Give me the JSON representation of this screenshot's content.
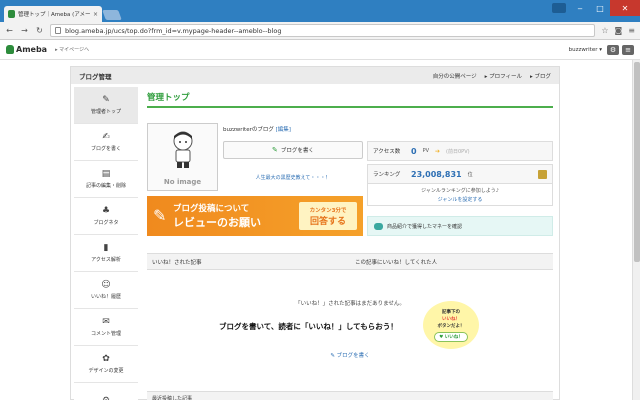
{
  "browser": {
    "tab_title": "管理トップ｜Ameba (アメーバ)",
    "tab_close": "×",
    "url": "blog.ameba.jp/ucs/top.do?frm_id=v.mypage-header--ameblo--blog"
  },
  "header": {
    "logo": "Ameba",
    "mypage": "▸ マイページへ",
    "user": "buzzwriter ▾"
  },
  "main": {
    "title": "ブログ管理",
    "links": [
      "自分の公開ページ",
      "▸ プロフィール",
      "▸ ブログ"
    ]
  },
  "sidebar": {
    "items": [
      {
        "label": "管理者トップ",
        "icon": "pencil-icon",
        "glyph": "✎"
      },
      {
        "label": "ブログを書く",
        "icon": "write-icon",
        "glyph": "✍"
      },
      {
        "label": "記事の編集・削除",
        "icon": "folder-icon",
        "glyph": "▤"
      },
      {
        "label": "ブログネタ",
        "icon": "sprout-icon",
        "glyph": "♣"
      },
      {
        "label": "アクセス解析",
        "icon": "bar-chart-icon",
        "glyph": "▮"
      },
      {
        "label": "いいね！履歴",
        "icon": "smile-icon",
        "glyph": "☺"
      },
      {
        "label": "コメント管理",
        "icon": "comment-icon",
        "glyph": "✉"
      },
      {
        "label": "デザインの変更",
        "icon": "palette-icon",
        "glyph": "✿"
      },
      {
        "label": "",
        "icon": "gear-icon",
        "glyph": "⚙"
      }
    ]
  },
  "content": {
    "page_title": "管理トップ",
    "no_image": "No image",
    "blog_name": "buzzwriterのブログ",
    "edit_link": "[編集]",
    "write_button": "ブログを書く",
    "promo_text": "人生最大の黒歴史教えて・・・！",
    "access_label": "アクセス数",
    "access_value": "0",
    "access_unit": "PV",
    "access_prev": "(前日0PV)",
    "ranking_label": "ランキング",
    "ranking_value": "23,008,831",
    "ranking_unit": "位",
    "genre_text": "ジャンルランキングに参加しよう♪",
    "genre_link": "ジャンルを設定する",
    "banner_line1": "ブログ投稿について",
    "banner_line2": "レビューのお願い",
    "banner_cta1": "カンタン3分で",
    "banner_cta2": "回答する",
    "market_text": "商品紹介で獲得したマネーを確認",
    "likes_col1": "いいね！された記事",
    "likes_col2": "この記事にいいね！してくれた人",
    "no_likes": "「いいね！」された記事はまだありません。",
    "cta_text": "ブログを書いて、読者に「いいね！」してもらおう！",
    "bubble1": "記事下の",
    "bubble2": "いいね！",
    "bubble3": "ボタンだよ！",
    "bubble_pill": "♥ いいね！",
    "write_link": "ブログを書く",
    "recent_label": "最近投稿した記事"
  }
}
